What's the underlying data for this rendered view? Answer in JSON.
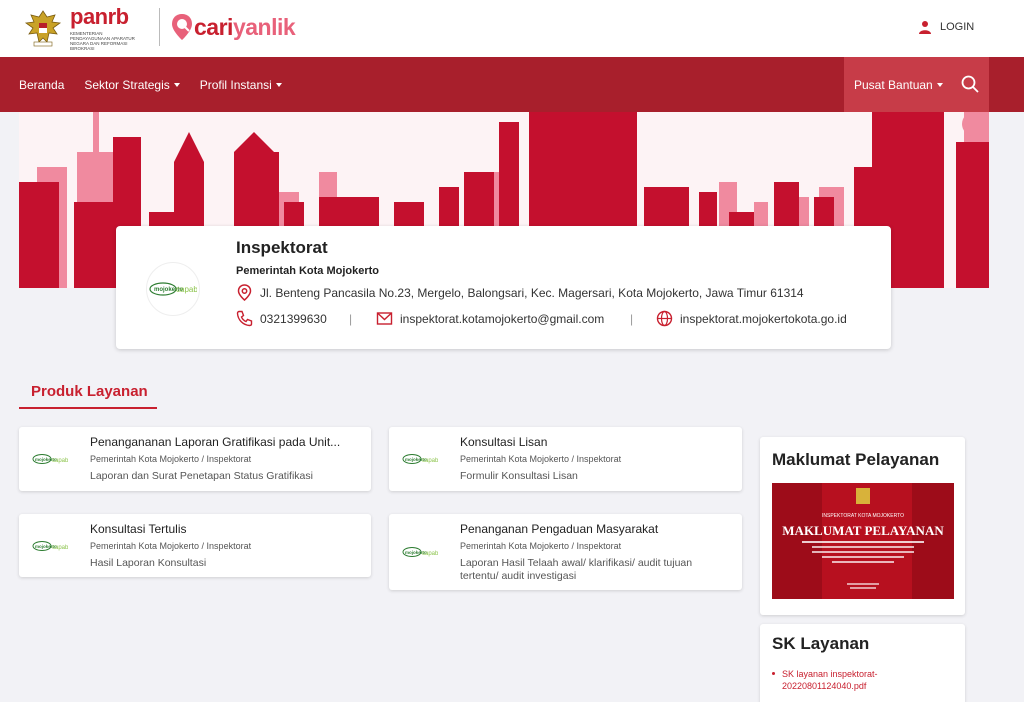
{
  "header": {
    "panrb_logo": "panrb",
    "panrb_subtitle": "KEMENTERIAN PENDAYAGUNAAN APARATUR NEGARA DAN REFORMASI BIROKRASI",
    "cari_logo_part1": "cari",
    "cari_logo_part2": "yanlik",
    "login_label": "LOGIN"
  },
  "nav": {
    "items": [
      {
        "label": "Beranda",
        "dropdown": false
      },
      {
        "label": "Sektor Strategis",
        "dropdown": true
      },
      {
        "label": "Profil Instansi",
        "dropdown": true
      }
    ],
    "help_label": "Pusat Bantuan"
  },
  "profile": {
    "name": "Inspektorat",
    "org": "Pemerintah Kota Mojokerto",
    "address": "Jl. Benteng Pancasila No.23, Mergelo, Balongsari, Kec. Magersari, Kota Mojokerto, Jawa Timur 61314",
    "phone": "0321399630",
    "email": "inspektorat.kotamojokerto@gmail.com",
    "website": "inspektorat.mojokertokota.go.id",
    "separator": "|"
  },
  "produk": {
    "title": "Produk Layanan",
    "services": [
      {
        "title": "Penangananan Laporan Gratifikasi pada Unit...",
        "org": "Pemerintah Kota Mojokerto / Inspektorat",
        "desc": "Laporan dan Surat Penetapan Status Gratifikasi"
      },
      {
        "title": "Konsultasi Lisan",
        "org": "Pemerintah Kota Mojokerto / Inspektorat",
        "desc": "Formulir Konsultasi Lisan"
      },
      {
        "title": "Konsultasi Tertulis",
        "org": "Pemerintah Kota Mojokerto / Inspektorat",
        "desc": "Hasil Laporan Konsultasi"
      },
      {
        "title": "Penanganan Pengaduan Masyarakat",
        "org": "Pemerintah Kota Mojokerto / Inspektorat",
        "desc": "Laporan Hasil Telaah awal/ klarifikasi/ audit tujuan tertentu/ audit investigasi"
      }
    ]
  },
  "maklumat": {
    "title": "Maklumat Pelayanan",
    "image_header": "INSPEKTORAT KOTA MOJOKERTO",
    "image_title": "MAKLUMAT PELAYANAN"
  },
  "sk": {
    "title": "SK Layanan",
    "link": "SK layanan inspektorat-20220801124040.pdf"
  },
  "logo_text": {
    "mojokerto": "mojokerto",
    "capable": "capable"
  },
  "colors": {
    "brand_red": "#c8202f",
    "nav_red": "#a81f2c",
    "nav_right": "#c73c48",
    "banner_red": "#c4102e",
    "banner_pink": "#f08a9f"
  },
  "icons": {
    "login": "user-icon",
    "search": "search-icon",
    "address": "map-pin-icon",
    "phone": "phone-icon",
    "email": "mail-icon",
    "website": "globe-icon"
  }
}
